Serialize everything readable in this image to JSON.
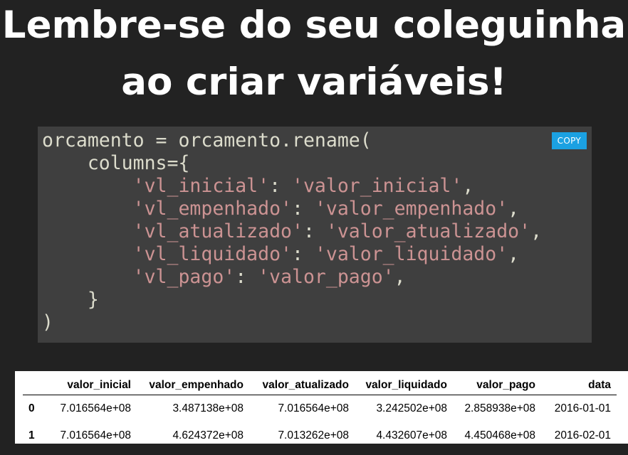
{
  "title": {
    "line1": "Lembre-se do seu coleguinha",
    "line2": "ao criar variáveis!"
  },
  "code": {
    "copy_label": "COPY",
    "lines": [
      {
        "plain": "orcamento = orcamento.rename("
      },
      {
        "plain": "    columns={"
      },
      {
        "key": "'vl_inicial'",
        "value": "'valor_inicial'"
      },
      {
        "key": "'vl_empenhado'",
        "value": "'valor_empenhado'"
      },
      {
        "key": "'vl_atualizado'",
        "value": "'valor_atualizado'"
      },
      {
        "key": "'vl_liquidado'",
        "value": "'valor_liquidado'"
      },
      {
        "key": "'vl_pago'",
        "value": "'valor_pago'"
      },
      {
        "plain": "    }"
      },
      {
        "plain": ")"
      }
    ]
  },
  "table": {
    "columns": [
      "",
      "valor_inicial",
      "valor_empenhado",
      "valor_atualizado",
      "valor_liquidado",
      "valor_pago",
      "data"
    ],
    "rows": [
      [
        "0",
        "7.016564e+08",
        "3.487138e+08",
        "7.016564e+08",
        "3.242502e+08",
        "2.858938e+08",
        "2016-01-01"
      ],
      [
        "1",
        "7.016564e+08",
        "4.624372e+08",
        "7.013262e+08",
        "4.432607e+08",
        "4.450468e+08",
        "2016-02-01"
      ]
    ]
  },
  "colors": {
    "background": "#222222",
    "code_background": "#3f3f3f",
    "code_text": "#dcdccc",
    "code_string": "#cc9393",
    "copy_button": "#1ba1e2"
  }
}
